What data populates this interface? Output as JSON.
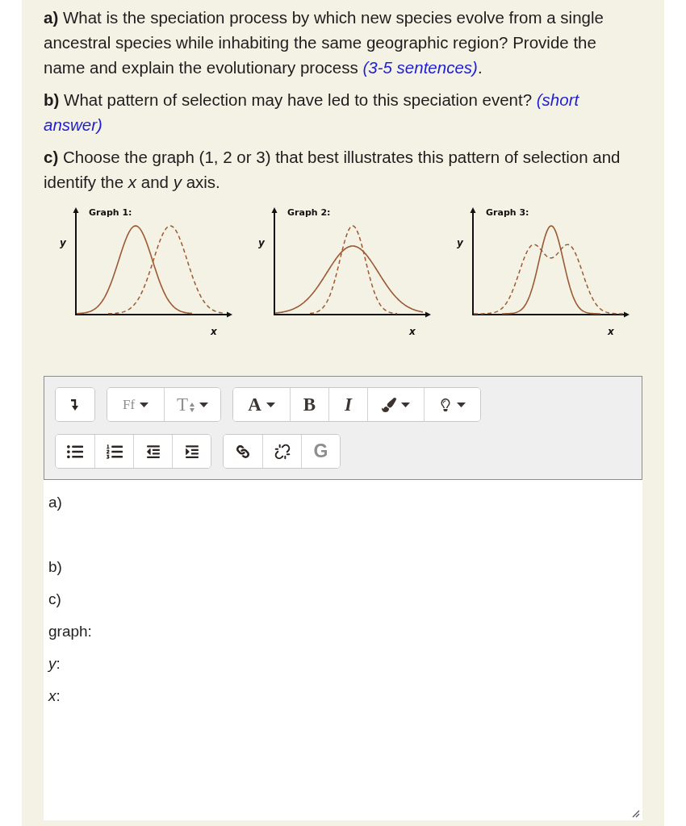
{
  "questions": [
    {
      "label": "a)",
      "text": "What is the speciation process by which new species evolve from a single ancestral species while inhabiting the same geographic region? Provide the name and explain the evolutionary process",
      "note": "(3-5 sentences)",
      "end": "."
    },
    {
      "label": "b)",
      "text": "What pattern of selection may have led to this speciation event?",
      "note": "(short answer)"
    },
    {
      "label": "c)",
      "text": "Choose the graph (1, 2 or 3) that best illustrates this pattern of selection and identify the *x* and *y* axis."
    }
  ],
  "graphs": [
    {
      "title": "Graph 1:",
      "ylabel": "y",
      "xlabel": "x",
      "kind": "shifted"
    },
    {
      "title": "Graph 2:",
      "ylabel": "y",
      "xlabel": "x",
      "kind": "narrowed"
    },
    {
      "title": "Graph 3:",
      "ylabel": "y",
      "xlabel": "x",
      "kind": "split"
    }
  ],
  "toolbar": {
    "rows": [
      {
        "groups": [
          {
            "buttons": [
              {
                "kind": "arrow",
                "dropdown": false
              }
            ]
          },
          {
            "buttons": [
              {
                "kind": "font",
                "label": "Ff",
                "dropdown": true
              },
              {
                "kind": "size",
                "label": "T",
                "dropdown": true
              }
            ]
          },
          {
            "buttons": [
              {
                "kind": "color",
                "label": "A",
                "dropdown": true
              },
              {
                "kind": "bold",
                "label": "B",
                "dropdown": false
              },
              {
                "kind": "italic",
                "label": "I",
                "dropdown": false
              },
              {
                "kind": "brush",
                "dropdown": true
              },
              {
                "kind": "bulb",
                "dropdown": true
              }
            ]
          }
        ]
      },
      {
        "groups": [
          {
            "buttons": [
              {
                "kind": "bullets",
                "dropdown": false
              },
              {
                "kind": "numbers",
                "dropdown": false
              },
              {
                "kind": "outdent",
                "dropdown": false
              },
              {
                "kind": "indent",
                "dropdown": false
              }
            ]
          },
          {
            "buttons": [
              {
                "kind": "link",
                "dropdown": false
              },
              {
                "kind": "unlink",
                "dropdown": false
              },
              {
                "kind": "glyph",
                "label": "G",
                "dropdown": false
              }
            ]
          }
        ]
      }
    ]
  },
  "editor": {
    "blocks": [
      {
        "lines": [
          "a)"
        ]
      },
      {
        "lines": [
          "b)",
          "c)",
          "graph:",
          "*y*:",
          "*x*:"
        ]
      }
    ]
  }
}
